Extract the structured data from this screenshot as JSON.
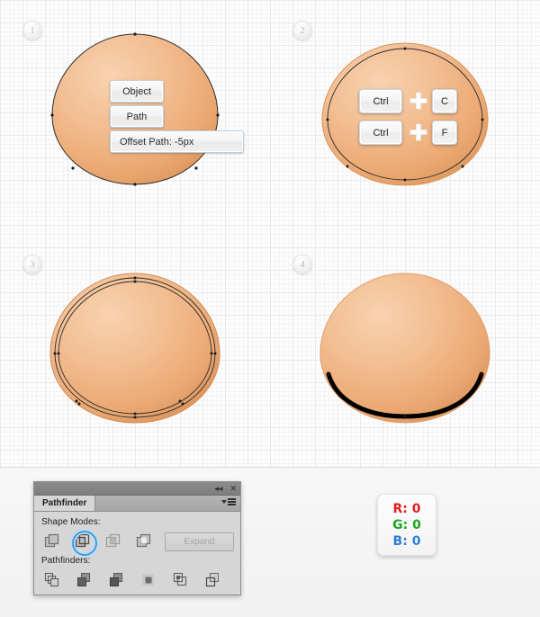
{
  "canvas": {
    "steps": [
      {
        "number": "1",
        "name": "step-1"
      },
      {
        "number": "2",
        "name": "step-2"
      },
      {
        "number": "3",
        "name": "step-3"
      },
      {
        "number": "4",
        "name": "step-4"
      }
    ]
  },
  "step1": {
    "menu": [
      {
        "label": "Object"
      },
      {
        "label": "Path"
      },
      {
        "label": "Offset Path: -5px"
      }
    ]
  },
  "step2": {
    "shortcuts": [
      {
        "modifier": "Ctrl",
        "plus": "+",
        "key": "C"
      },
      {
        "modifier": "Ctrl",
        "plus": "+",
        "key": "F"
      }
    ]
  },
  "pathfinder": {
    "title": "Pathfinder",
    "collapse_icon": "◂◂",
    "close_icon": "✕",
    "menu_icon": "panel-menu-icon",
    "shape_modes_label": "Shape Modes:",
    "pathfinders_label": "Pathfinders:",
    "expand_label": "Expand",
    "shape_modes": [
      {
        "name": "unite",
        "selected": false
      },
      {
        "name": "minus-front",
        "selected": true
      },
      {
        "name": "intersect",
        "selected": false
      },
      {
        "name": "exclude",
        "selected": false
      }
    ],
    "pathfinder_ops": [
      {
        "name": "divide"
      },
      {
        "name": "trim"
      },
      {
        "name": "merge"
      },
      {
        "name": "crop"
      },
      {
        "name": "outline"
      },
      {
        "name": "minus-back"
      }
    ]
  },
  "color_card": {
    "r_label": "R: 0",
    "g_label": "G: 0",
    "b_label": "B: 0",
    "r_color": "#e01f1f",
    "g_color": "#1fa81f",
    "b_color": "#2f7fd6"
  },
  "palette": {
    "shape_light": "#f6c9a2",
    "shape_mid": "#efb484",
    "shape_dark": "#e09a5f",
    "stroke": "#2a2a2a",
    "accent_blue": "#3d9be0",
    "canvas_bg": "#fdfdfd",
    "panel_bg": "#d6d6d6"
  }
}
